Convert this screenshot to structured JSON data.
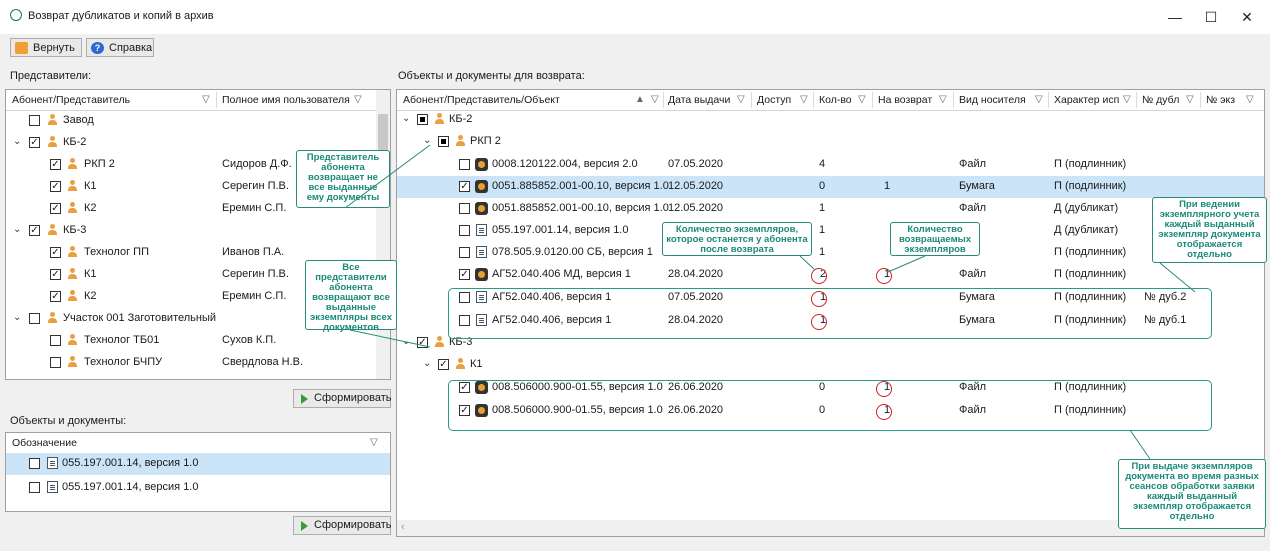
{
  "window": {
    "title": "Возврат дубликатов и копий в архив",
    "controls": {
      "minimize": "—",
      "maximize": "☐",
      "close": "✕"
    }
  },
  "toolbar": {
    "return_label": "Вернуть",
    "help_label": "Справка"
  },
  "left": {
    "section_label": "Представители:",
    "columns": [
      "Абонент/Представитель",
      "Полное имя пользователя"
    ],
    "rows": [
      {
        "name": "Завод",
        "user": ""
      },
      {
        "name": "КБ-2",
        "user": ""
      },
      {
        "name": "РКП 2",
        "user": "Сидоров Д.Ф."
      },
      {
        "name": "К1",
        "user": "Серегин П.В."
      },
      {
        "name": "К2",
        "user": "Еремин С.П."
      },
      {
        "name": "КБ-3",
        "user": ""
      },
      {
        "name": "Технолог ПП",
        "user": "Иванов П.А."
      },
      {
        "name": "К1",
        "user": "Серегин П.В."
      },
      {
        "name": "К2",
        "user": "Еремин С.П."
      },
      {
        "name": "Участок 001 Заготовительный",
        "user": ""
      },
      {
        "name": "Технолог ТБ01",
        "user": "Сухов К.П."
      },
      {
        "name": "Технолог БЧПУ",
        "user": "Свердлова Н.В."
      }
    ],
    "generate_label": "Сформировать",
    "objects_label": "Объекты и документы:",
    "obj_column": "Обозначение",
    "obj_rows": [
      "055.197.001.14, версия 1.0",
      "055.197.001.14, версия 1.0"
    ],
    "generate_label2": "Сформировать"
  },
  "right": {
    "section_label": "Объекты и документы для возврата:",
    "columns": [
      "Абонент/Представитель/Объект",
      "Дата выдачи",
      "Доступ",
      "Кол-во",
      "На возврат",
      "Вид носителя",
      "Характер исп",
      "№ дубл",
      "№ экз"
    ],
    "rows": [
      {
        "name": "КБ-2",
        "date": "",
        "qty": "",
        "ret": "",
        "media": "",
        "usage": "",
        "dup": ""
      },
      {
        "name": "РКП 2",
        "date": "",
        "qty": "",
        "ret": "",
        "media": "",
        "usage": "",
        "dup": ""
      },
      {
        "name": "0008.120122.004, версия 2.0",
        "date": "07.05.2020",
        "qty": "4",
        "ret": "",
        "media": "Файл",
        "usage": "П (подлинник)",
        "dup": ""
      },
      {
        "name": "0051.885852.001-00.10, версия 1.0",
        "date": "12.05.2020",
        "qty": "0",
        "ret": "1",
        "media": "Бумага",
        "usage": "П (подлинник)",
        "dup": ""
      },
      {
        "name": "0051.885852.001-00.10, версия 1.0",
        "date": "12.05.2020",
        "qty": "1",
        "ret": "",
        "media": "Файл",
        "usage": "Д (дубликат)",
        "dup": ""
      },
      {
        "name": "055.197.001.14, версия 1.0",
        "date": "",
        "qty": "1",
        "ret": "",
        "media": "",
        "usage": "Д (дубликат)",
        "dup": ""
      },
      {
        "name": "078.505.9.0120.00 СБ, версия 1",
        "date": "",
        "qty": "1",
        "ret": "",
        "media": "",
        "usage": "П (подлинник)",
        "dup": ""
      },
      {
        "name": "АГ52.040.406 МД, версия 1",
        "date": "28.04.2020",
        "qty": "2",
        "ret": "1",
        "media": "Файл",
        "usage": "П (подлинник)",
        "dup": ""
      },
      {
        "name": "АГ52.040.406, версия 1",
        "date": "07.05.2020",
        "qty": "1",
        "ret": "",
        "media": "Бумага",
        "usage": "П (подлинник)",
        "dup": "№ дуб.2"
      },
      {
        "name": "АГ52.040.406, версия 1",
        "date": "28.04.2020",
        "qty": "1",
        "ret": "",
        "media": "Бумага",
        "usage": "П (подлинник)",
        "dup": "№ дуб.1"
      },
      {
        "name": "КБ-3",
        "date": "",
        "qty": "",
        "ret": "",
        "media": "",
        "usage": "",
        "dup": ""
      },
      {
        "name": "К1",
        "date": "",
        "qty": "",
        "ret": "",
        "media": "",
        "usage": "",
        "dup": ""
      },
      {
        "name": "008.506000.900-01.55, версия 1.0",
        "date": "26.06.2020",
        "qty": "0",
        "ret": "1",
        "media": "Файл",
        "usage": "П (подлинник)",
        "dup": ""
      },
      {
        "name": "008.506000.900-01.55, версия 1.0",
        "date": "26.06.2020",
        "qty": "0",
        "ret": "1",
        "media": "Файл",
        "usage": "П (подлинник)",
        "dup": ""
      }
    ]
  },
  "callouts": {
    "c1": "Представитель абонента возвращает не все выданные ему документы",
    "c2": "Все представители абонента возвращают все выданные экземпляры всех документов",
    "c3": "Количество экземпляров, которое останется у абонента после возврата",
    "c4": "Количество возвращаемых экземпляров",
    "c5": "При ведении экземплярного учета каждый выданный экземпляр документа отображается отдельно",
    "c6": "При выдаче экземпляров документа во время разных сеансов обработки заявки каждый выданный экземпляр отображается отдельно"
  },
  "colors": {
    "accent": "#2a9a8a",
    "selection": "#cce4f7",
    "circle": "#d02020"
  }
}
